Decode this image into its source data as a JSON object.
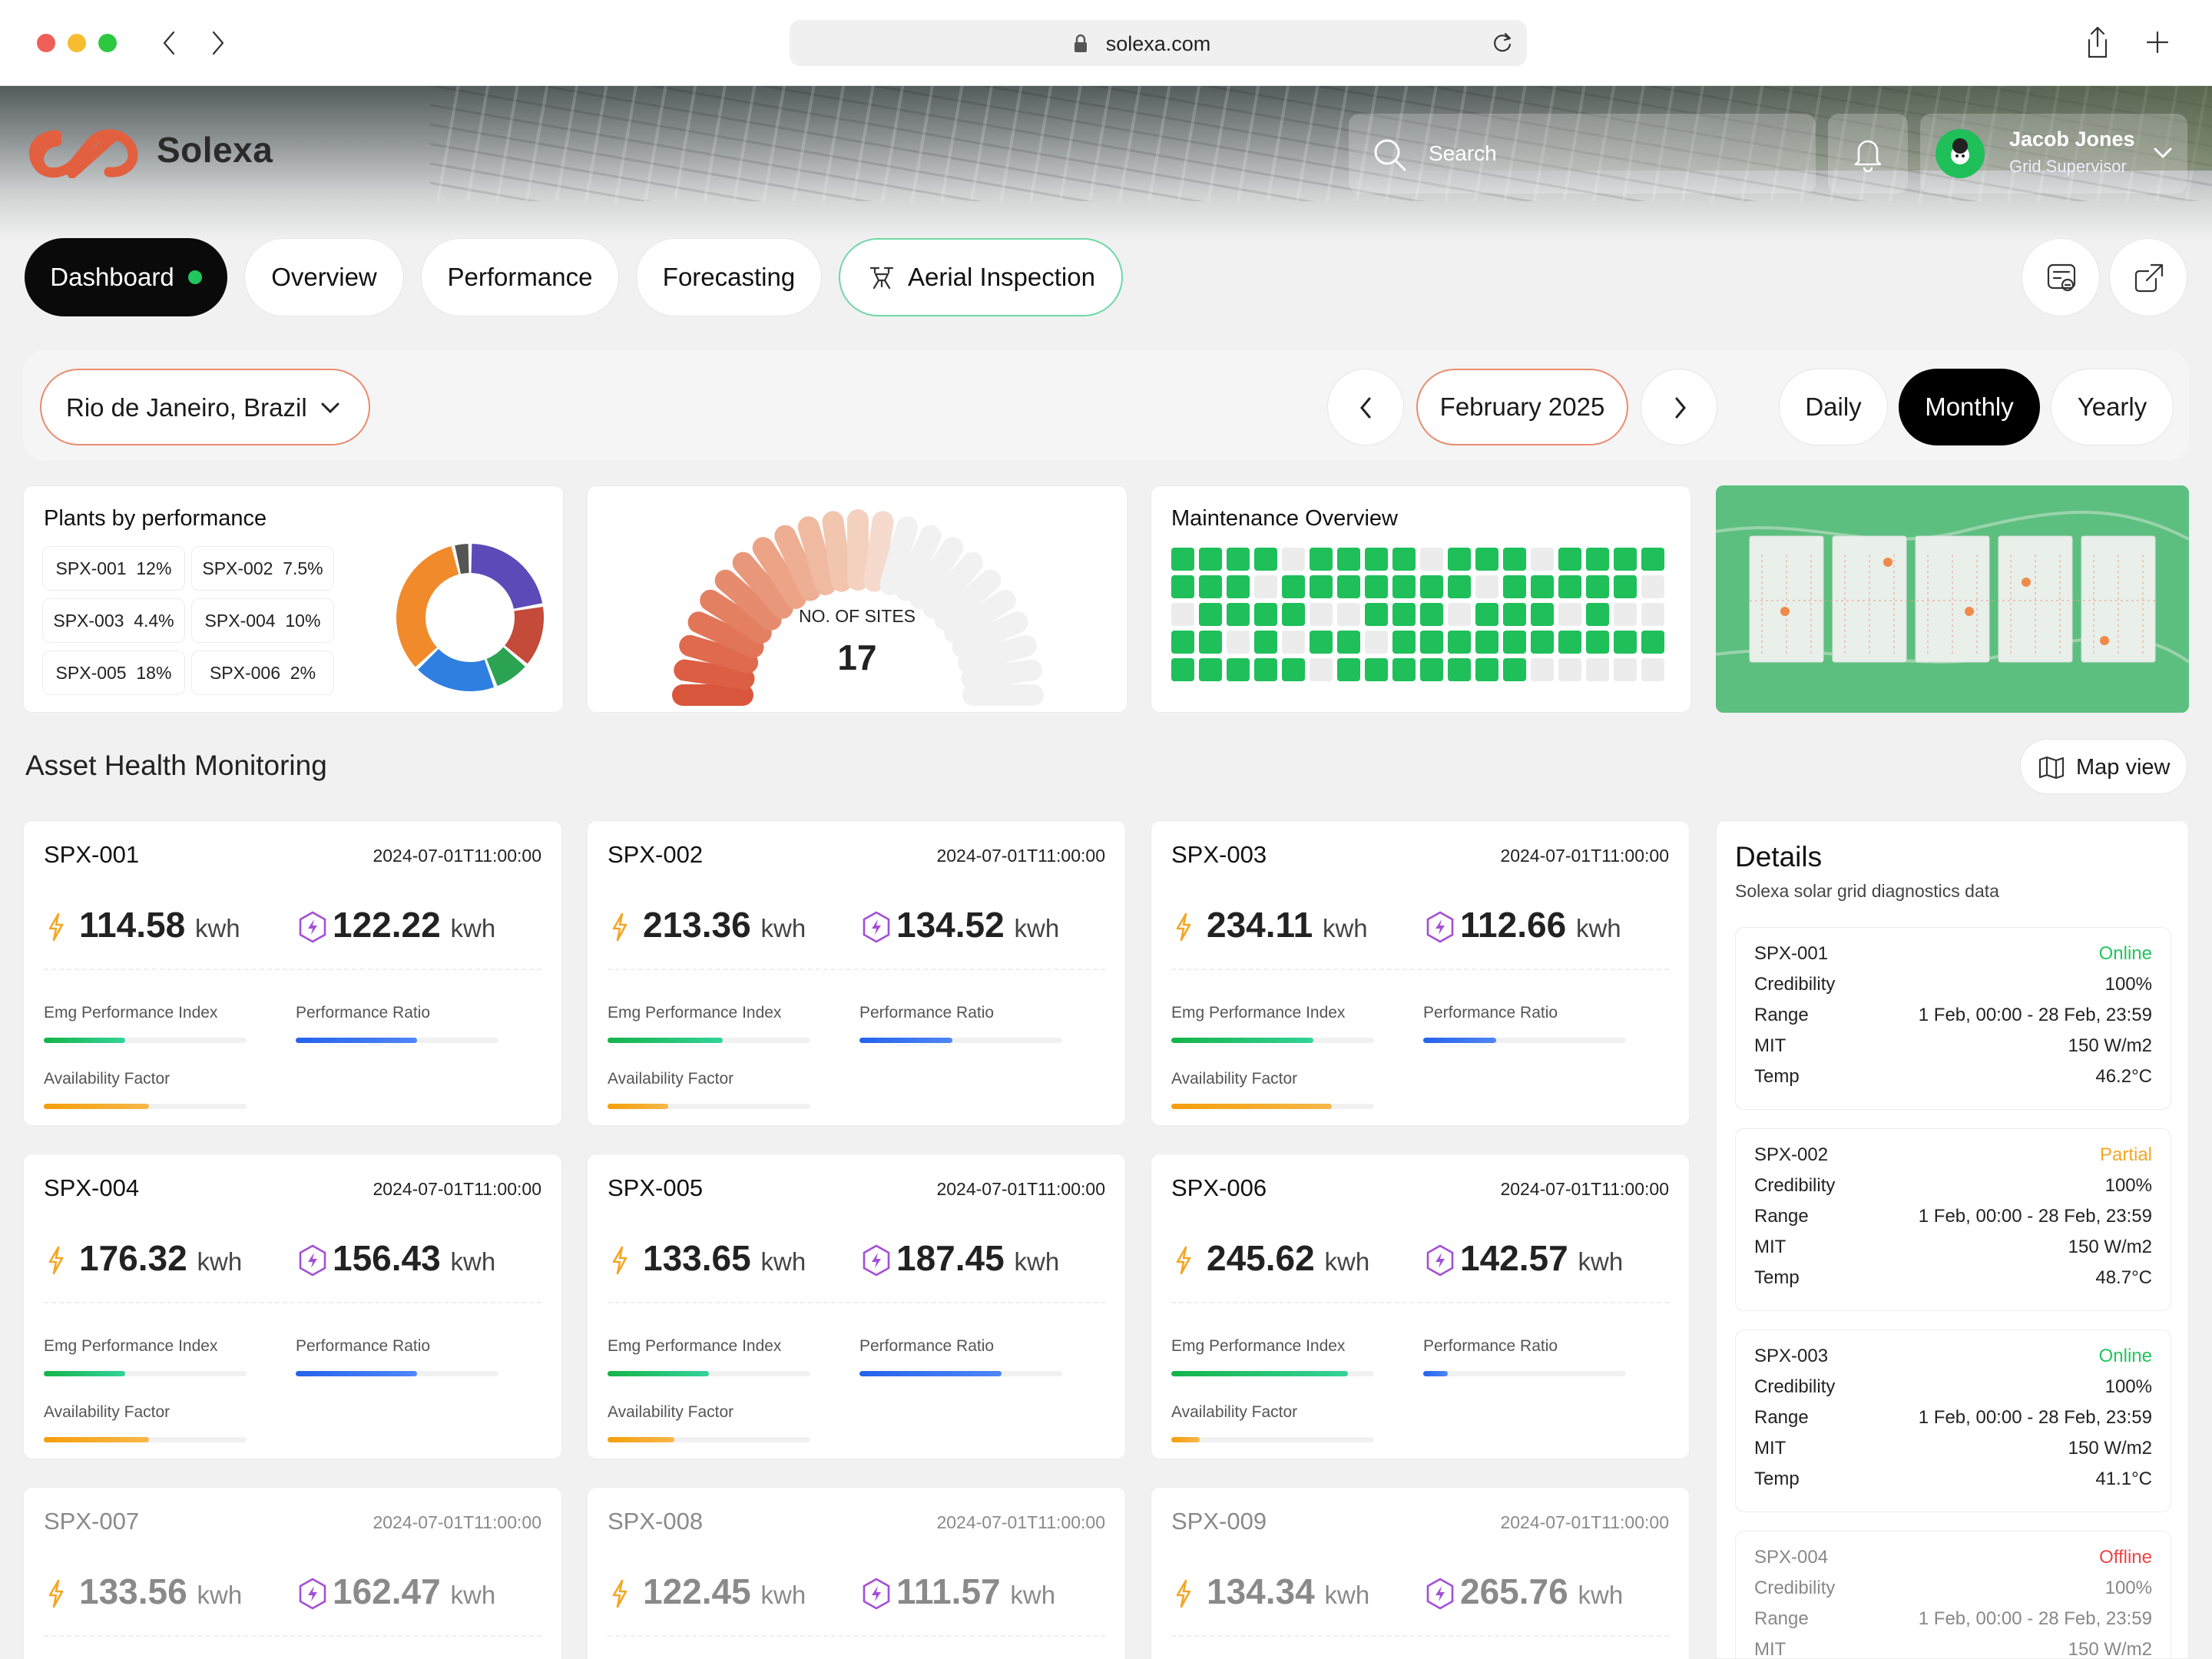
{
  "browser": {
    "url": "solexa.com"
  },
  "header": {
    "brand": "Solexa",
    "search_placeholder": "Search",
    "user": {
      "name": "Jacob Jones",
      "role": "Grid Supervisor"
    }
  },
  "nav": {
    "tabs": [
      {
        "label": "Dashboard",
        "active": true
      },
      {
        "label": "Overview"
      },
      {
        "label": "Performance"
      },
      {
        "label": "Forecasting"
      },
      {
        "label": "Aerial Inspection"
      }
    ]
  },
  "filters": {
    "location": "Rio de Janeiro, Brazil",
    "period": "February 2025",
    "ranges": [
      "Daily",
      "Monthly",
      "Yearly"
    ],
    "active_range": "Monthly"
  },
  "plants_by_performance": {
    "title": "Plants by performance",
    "items": [
      {
        "label": "SPX-001",
        "value": "12%",
        "color": "#5c4ab8"
      },
      {
        "label": "SPX-002",
        "value": "7.5%",
        "color": "#c44a3a"
      },
      {
        "label": "SPX-003",
        "value": "4.4%",
        "color": "#2ba353"
      },
      {
        "label": "SPX-004",
        "value": "10%",
        "color": "#2f7fe0"
      },
      {
        "label": "SPX-005",
        "value": "18%",
        "color": "#f08a2a"
      },
      {
        "label": "SPX-006",
        "value": "2%",
        "color": "#555555"
      }
    ]
  },
  "sites_gauge": {
    "label": "NO. OF SITES",
    "value": "17"
  },
  "maintenance": {
    "title": "Maintenance Overview",
    "grid": [
      [
        1,
        1,
        1,
        1,
        0,
        1,
        1,
        1,
        1,
        0,
        1,
        1,
        1,
        0,
        1,
        1,
        1,
        1
      ],
      [
        1,
        1,
        1,
        0,
        1,
        1,
        1,
        1,
        1,
        1,
        1,
        0,
        1,
        1,
        1,
        1,
        1,
        0
      ],
      [
        0,
        1,
        1,
        1,
        1,
        0,
        0,
        1,
        1,
        1,
        0,
        1,
        1,
        1,
        0,
        1,
        0,
        0
      ],
      [
        1,
        1,
        0,
        1,
        0,
        1,
        1,
        0,
        1,
        1,
        1,
        1,
        1,
        1,
        1,
        1,
        1,
        1
      ],
      [
        1,
        1,
        1,
        1,
        1,
        0,
        1,
        1,
        1,
        1,
        1,
        1,
        1,
        0,
        0,
        0,
        0,
        0
      ]
    ]
  },
  "section": {
    "title": "Asset Health Monitoring",
    "map_view": "Map view"
  },
  "labels": {
    "emg": "Emg Performance Index",
    "pr": "Performance Ratio",
    "af": "Availability Factor",
    "unit": "kwh"
  },
  "assets": [
    {
      "id": "SPX-001",
      "ts": "2024-07-01T11:00:00",
      "energy": "114.58",
      "power": "122.22",
      "emg": 0.4,
      "pr": 0.6,
      "af": 0.52
    },
    {
      "id": "SPX-002",
      "ts": "2024-07-01T11:00:00",
      "energy": "213.36",
      "power": "134.52",
      "emg": 0.57,
      "pr": 0.46,
      "af": 0.3
    },
    {
      "id": "SPX-003",
      "ts": "2024-07-01T11:00:00",
      "energy": "234.11",
      "power": "112.66",
      "emg": 0.7,
      "pr": 0.36,
      "af": 0.79
    },
    {
      "id": "SPX-004",
      "ts": "2024-07-01T11:00:00",
      "energy": "176.32",
      "power": "156.43",
      "emg": 0.4,
      "pr": 0.6,
      "af": 0.52
    },
    {
      "id": "SPX-005",
      "ts": "2024-07-01T11:00:00",
      "energy": "133.65",
      "power": "187.45",
      "emg": 0.5,
      "pr": 0.7,
      "af": 0.33
    },
    {
      "id": "SPX-006",
      "ts": "2024-07-01T11:00:00",
      "energy": "245.62",
      "power": "142.57",
      "emg": 0.87,
      "pr": 0.12,
      "af": 0.14
    },
    {
      "id": "SPX-007",
      "ts": "2024-07-01T11:00:00",
      "energy": "133.56",
      "power": "162.47"
    },
    {
      "id": "SPX-008",
      "ts": "2024-07-01T11:00:00",
      "energy": "122.45",
      "power": "111.57"
    },
    {
      "id": "SPX-009",
      "ts": "2024-07-01T11:00:00",
      "energy": "134.34",
      "power": "265.76"
    }
  ],
  "details": {
    "title": "Details",
    "subtitle": "Solexa solar grid diagnostics data",
    "row_labels": [
      "Credibility",
      "Range",
      "MIT",
      "Temp"
    ],
    "status_colors": {
      "Online": "#22c55e",
      "Partial": "#f5a623",
      "Offline": "#ef4444"
    },
    "items": [
      {
        "id": "SPX-001",
        "status": "Online",
        "credibility": "100%",
        "range": "1 Feb, 00:00 - 28 Feb, 23:59",
        "mit": "150 W/m2",
        "temp": "46.2°C"
      },
      {
        "id": "SPX-002",
        "status": "Partial",
        "credibility": "100%",
        "range": "1 Feb, 00:00 - 28 Feb, 23:59",
        "mit": "150 W/m2",
        "temp": "48.7°C"
      },
      {
        "id": "SPX-003",
        "status": "Online",
        "credibility": "100%",
        "range": "1 Feb, 00:00 - 28 Feb, 23:59",
        "mit": "150 W/m2",
        "temp": "41.1°C"
      },
      {
        "id": "SPX-004",
        "status": "Offline",
        "credibility": "100%",
        "range": "1 Feb, 00:00 - 28 Feb, 23:59",
        "mit": "150 W/m2"
      }
    ]
  },
  "colors": {
    "accent": "#e2603f",
    "green": "#22c55e",
    "blue": "#2563eb",
    "orange": "#f59e0b"
  }
}
